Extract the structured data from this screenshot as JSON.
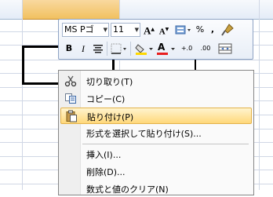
{
  "mini_toolbar": {
    "font_name": "MS Pゴ",
    "font_size": "11",
    "grow_font_glyph": "A",
    "shrink_font_glyph": "A",
    "percent_glyph": "%",
    "comma_glyph": ",",
    "bold_glyph": "B",
    "italic_glyph": "I",
    "font_color_glyph": "A",
    "inc_decimal_glyph": "+.0",
    "dec_decimal_glyph": ".00",
    "colors": {
      "font_color": "#e81f1f",
      "highlight_color": "#ffd800"
    }
  },
  "context_menu": {
    "items": [
      {
        "label": "切り取り(T)",
        "icon": "scissors-icon"
      },
      {
        "label": "コピー(C)",
        "icon": "copy-icon"
      },
      {
        "label": "貼り付け(P)",
        "icon": "clipboard-icon",
        "highlighted": true
      },
      {
        "label": "形式を選択して貼り付け(S)..."
      },
      {
        "label": "挿入(I)..."
      },
      {
        "label": "削除(D)..."
      },
      {
        "label": "数式と値のクリア(N)"
      }
    ]
  }
}
